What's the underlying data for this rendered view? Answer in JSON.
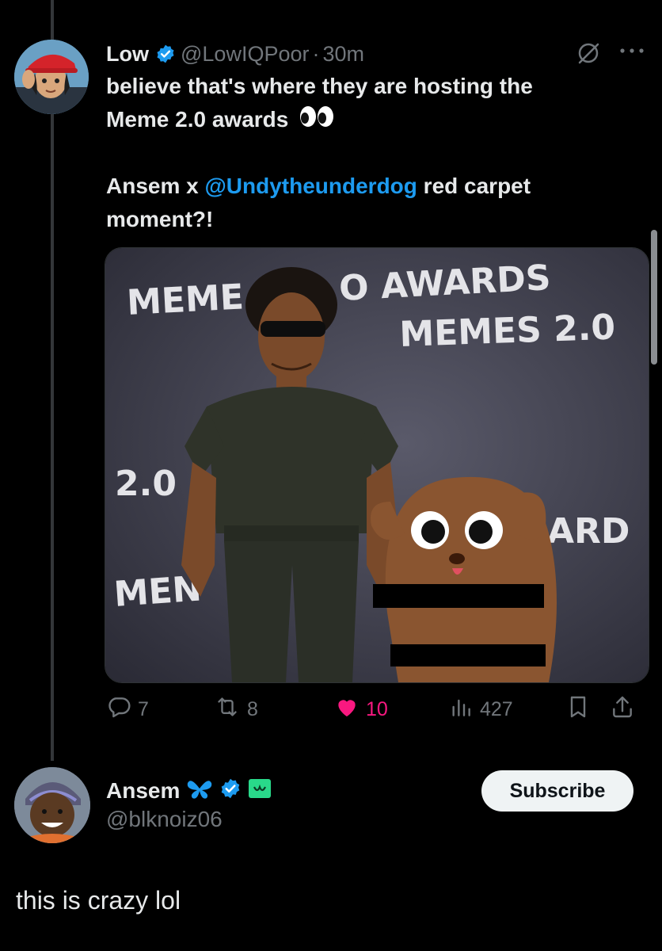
{
  "tweet1": {
    "name": "Low",
    "handle": "@LowIQPoor",
    "separator": "·",
    "time": "30m",
    "line1": "believe that's where they are hosting the",
    "line2": "Meme 2.0 awards",
    "line3_prefix": "Ansem x ",
    "line3_mention": "@Undytheunderdog",
    "line3_suffix": " red carpet",
    "line4": "moment?!",
    "image": {
      "wall_text_1": "MEME",
      "wall_text_2": "O AWARDS",
      "wall_text_3": "MEMES 2.0",
      "wall_text_4": "2.0",
      "wall_text_5": "ARD",
      "wall_text_6": "MEN"
    },
    "actions": {
      "replies": "7",
      "reposts": "8",
      "likes": "10",
      "views": "427"
    },
    "icons": {
      "verified": "verified-badge-icon",
      "grok": "grok-icon",
      "more": "more-icon",
      "reply": "reply-icon",
      "repost": "repost-icon",
      "like": "heart-icon",
      "views": "views-icon",
      "bookmark": "bookmark-icon",
      "share": "share-icon"
    },
    "colors": {
      "mention": "#1d9bf0",
      "like": "#f91880",
      "verified": "#1d9bf0"
    }
  },
  "tweet2": {
    "name": "Ansem",
    "handle": "@blknoiz06",
    "subscribe_label": "Subscribe",
    "text": "this is crazy lol"
  }
}
